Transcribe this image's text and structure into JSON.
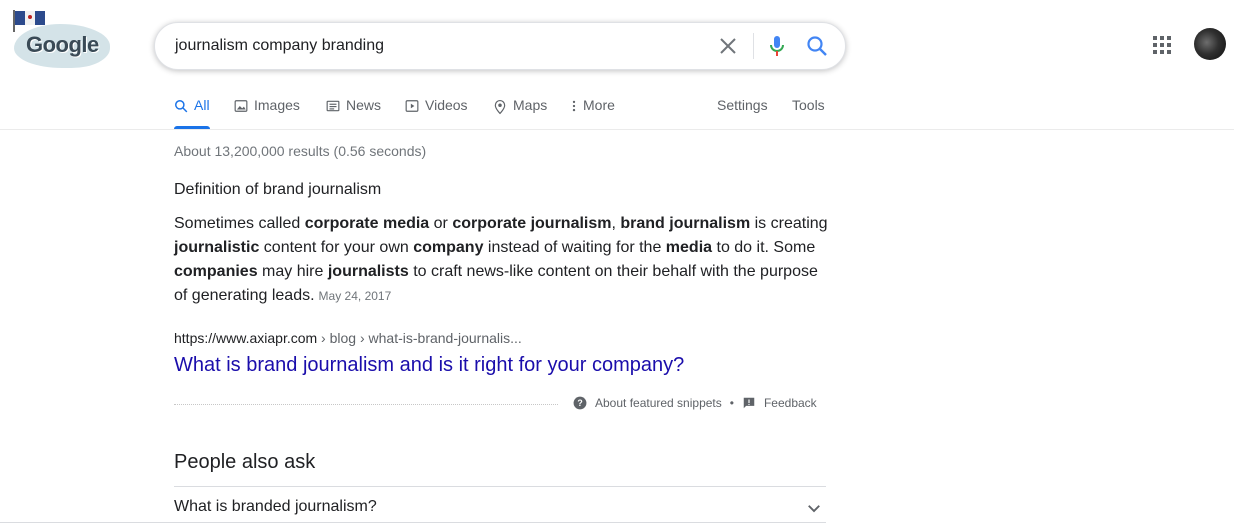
{
  "logo": {
    "text": "Google"
  },
  "search": {
    "query": "journalism company branding"
  },
  "tabs": [
    {
      "label": "All",
      "icon": "search-icon"
    },
    {
      "label": "Images",
      "icon": "image-icon"
    },
    {
      "label": "News",
      "icon": "newspaper-icon"
    },
    {
      "label": "Videos",
      "icon": "play-icon"
    },
    {
      "label": "Maps",
      "icon": "map-pin-icon"
    },
    {
      "label": "More",
      "icon": "kebab-icon"
    }
  ],
  "tools": {
    "settings_label": "Settings",
    "tools_label": "Tools"
  },
  "stats": "About 13,200,000 results (0.56 seconds)",
  "snippet": {
    "heading": "Definition of brand journalism",
    "body": [
      {
        "t": "Sometimes called "
      },
      {
        "t": "corporate media",
        "b": true
      },
      {
        "t": " or "
      },
      {
        "t": "corporate journalism",
        "b": true
      },
      {
        "t": ", "
      },
      {
        "t": "brand journalism",
        "b": true
      },
      {
        "t": " is creating "
      },
      {
        "t": "journalistic",
        "b": true
      },
      {
        "t": " content for your own "
      },
      {
        "t": "company",
        "b": true
      },
      {
        "t": " instead of waiting for the "
      },
      {
        "t": "media",
        "b": true
      },
      {
        "t": " to do it. Some "
      },
      {
        "t": "companies",
        "b": true
      },
      {
        "t": " may hire "
      },
      {
        "t": "journalists",
        "b": true
      },
      {
        "t": " to craft news-like content on their behalf with the purpose of generating leads."
      }
    ],
    "date": "May 24, 2017",
    "cite_domain": "https://www.axiapr.com",
    "cite_path": " › blog › what-is-brand-journalis...",
    "title": "What is brand journalism and is it right for your company?",
    "about_label": "About featured snippets",
    "separator": "•",
    "feedback_label": "Feedback"
  },
  "people_also_ask": {
    "title": "People also ask",
    "questions": [
      "What is branded journalism?"
    ]
  },
  "colors": {
    "accent": "#1a73e8",
    "link": "#1a0dab"
  }
}
